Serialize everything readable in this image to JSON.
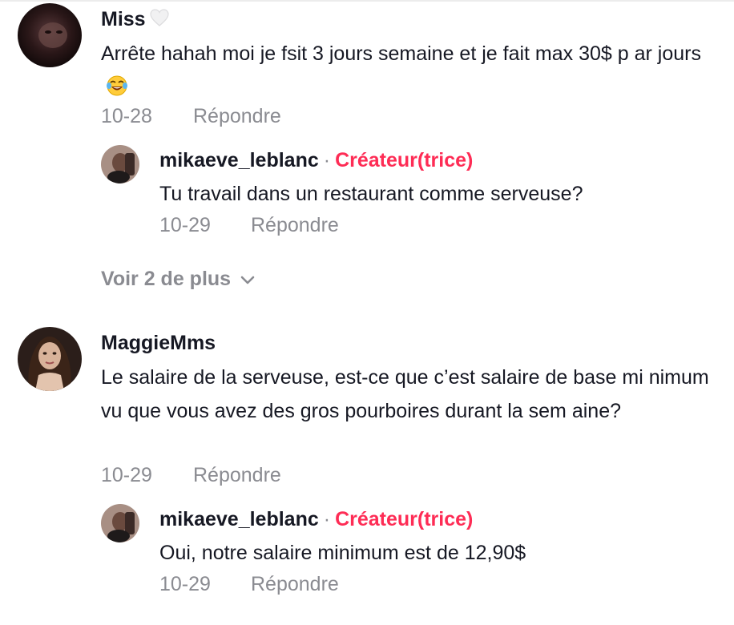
{
  "comments": [
    {
      "username": "Miss",
      "username_icon": "white-heart-icon",
      "text": "Arrête hahah moi je fsit 3 jours semaine et je fait max 30$ p ar jours",
      "text_emoji": "face-with-tears-of-joy-icon",
      "date": "10-28",
      "reply_label": "Répondre",
      "replies": [
        {
          "username": "mikaeve_leblanc",
          "separator": "·",
          "badge": "Créateur(trice)",
          "text": "Tu travail dans un restaurant comme serveuse?",
          "date": "10-29",
          "reply_label": "Répondre"
        }
      ],
      "view_more_label": "Voir 2 de plus"
    },
    {
      "username": "MaggieMms",
      "text": "Le salaire de la serveuse, est-ce que c’est salaire de base mi nimum vu que vous avez des gros pourboires durant la sem aine?",
      "date": "10-29",
      "reply_label": "Répondre",
      "replies": [
        {
          "username": "mikaeve_leblanc",
          "separator": "·",
          "badge": "Créateur(trice)",
          "text": "Oui, notre salaire minimum est de 12,90$",
          "date": "10-29",
          "reply_label": "Répondre"
        }
      ]
    }
  ],
  "colors": {
    "text": "#161823",
    "muted": "#8a8b91",
    "creator_badge": "#fe2c55"
  }
}
